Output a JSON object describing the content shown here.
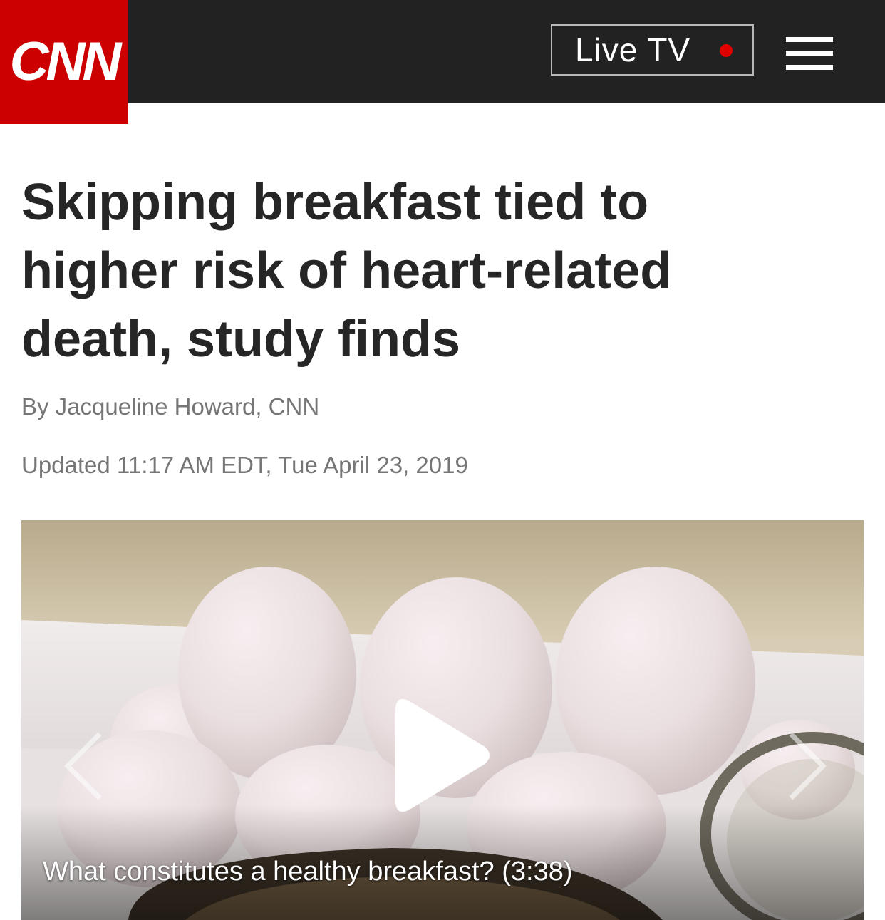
{
  "header": {
    "logo_text": "CNN",
    "live_tv_label": "Live TV",
    "live_dot_color": "#e00000",
    "brand_color": "#cc0000",
    "bar_color": "#222222"
  },
  "article": {
    "headline": "Skipping breakfast tied to higher risk of heart-related death, study finds",
    "byline": "By Jacqueline Howard, CNN",
    "updated": "Updated 11:17 AM EDT, Tue April 23, 2019"
  },
  "video": {
    "caption": "What constitutes a healthy breakfast? (3:38)"
  }
}
